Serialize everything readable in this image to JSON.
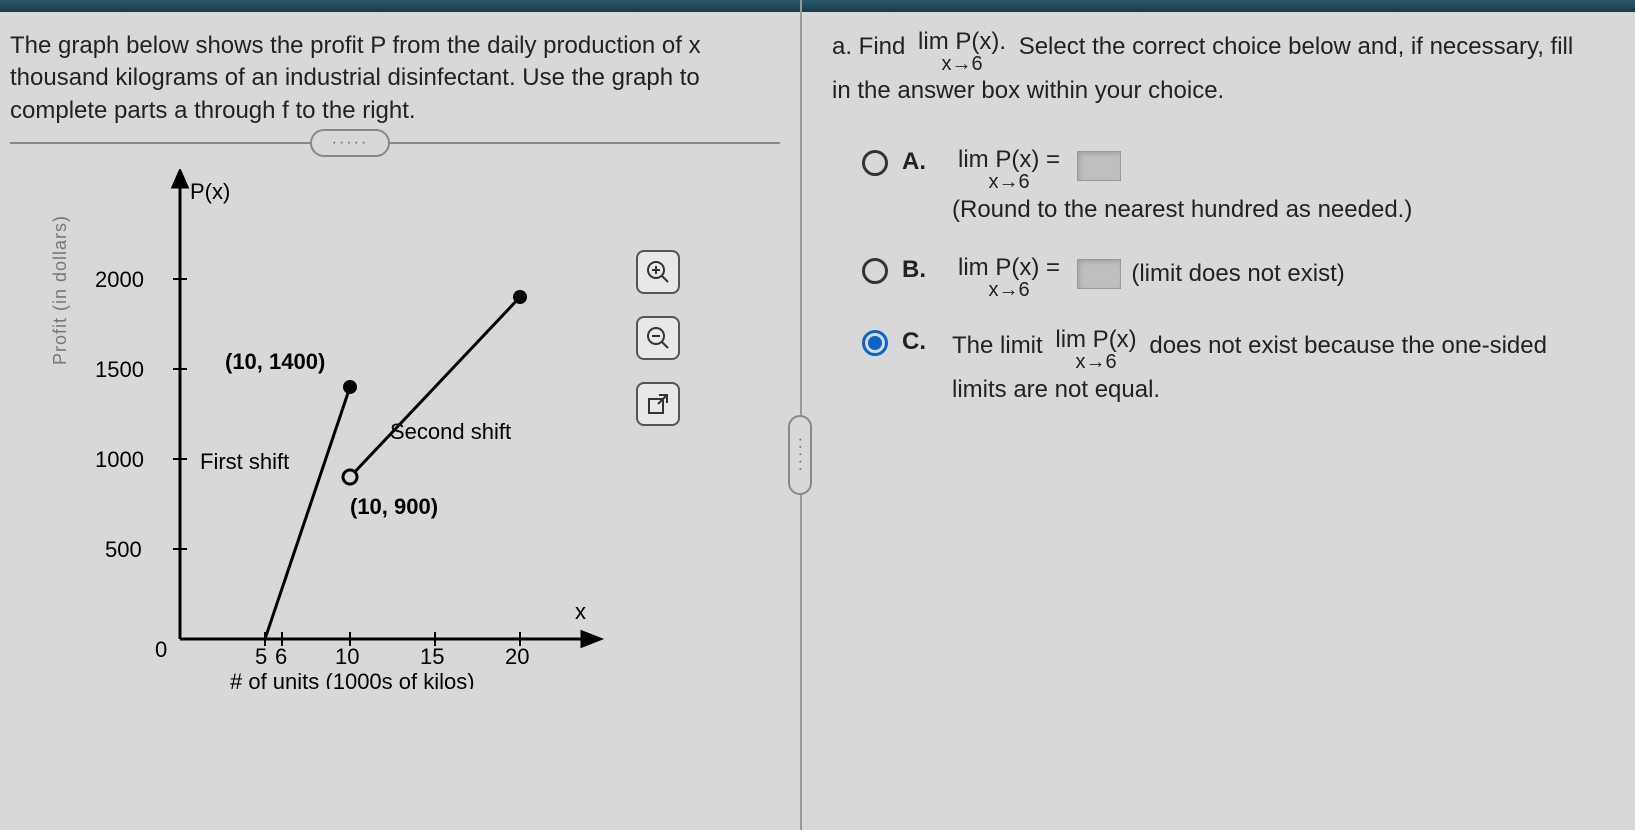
{
  "left": {
    "prompt": "The graph below shows the profit P from the daily production of x thousand kilograms of an industrial disinfectant. Use the graph to complete parts a through f to the right.",
    "graph": {
      "y_axis_label_top": "P(x)",
      "x_axis_label_right": "x",
      "y_axis_rotated": "Profit (in dollars)",
      "x_axis_caption": "# of units (1000s of kilos)",
      "annotations": {
        "first_shift": "First shift",
        "second_shift": "Second shift",
        "pt1": "(10, 1400)",
        "pt2": "(10, 900)"
      },
      "y_ticks": [
        "500",
        "1000",
        "1500",
        "2000"
      ],
      "x_ticks_origin": "0",
      "x_ticks": [
        "5",
        "6",
        "10",
        "15",
        "20"
      ]
    }
  },
  "right": {
    "question_prefix": "a. Find",
    "question_limit_top": "lim P(x).",
    "question_limit_bot": "x→6",
    "question_suffix": "Select the correct choice below and, if necessary, fill in the answer box within your choice.",
    "A": {
      "letter": "A.",
      "line1_top": "lim P(x) =",
      "line1_bot": "x→6",
      "line2": "(Round to the nearest hundred as needed.)"
    },
    "B": {
      "letter": "B.",
      "line1_top": "lim P(x) =",
      "line1_bot": "x→6",
      "suffix": "(limit does not exist)"
    },
    "C": {
      "letter": "C.",
      "text1": "The limit",
      "lim_top": "lim P(x)",
      "lim_bot": "x→6",
      "text2": "does not exist because the one-sided limits are not equal."
    }
  },
  "chart_data": {
    "type": "line",
    "xlabel": "# of units (1000s of kilos)",
    "ylabel": "Profit (in dollars)",
    "xlim": [
      0,
      22
    ],
    "ylim": [
      0,
      2200
    ],
    "y_ticks": [
      500,
      1000,
      1500,
      2000
    ],
    "x_ticks": [
      5,
      6,
      10,
      15,
      20
    ],
    "series": [
      {
        "name": "First shift",
        "x": [
          5,
          10
        ],
        "y": [
          0,
          1400
        ],
        "right_endpoint": "closed"
      },
      {
        "name": "Second shift",
        "x": [
          10,
          20
        ],
        "y": [
          900,
          1900
        ],
        "left_endpoint": "open",
        "right_endpoint": "closed"
      }
    ],
    "labeled_points": [
      {
        "x": 10,
        "y": 1400,
        "label": "(10, 1400)"
      },
      {
        "x": 10,
        "y": 900,
        "label": "(10, 900)"
      }
    ]
  }
}
